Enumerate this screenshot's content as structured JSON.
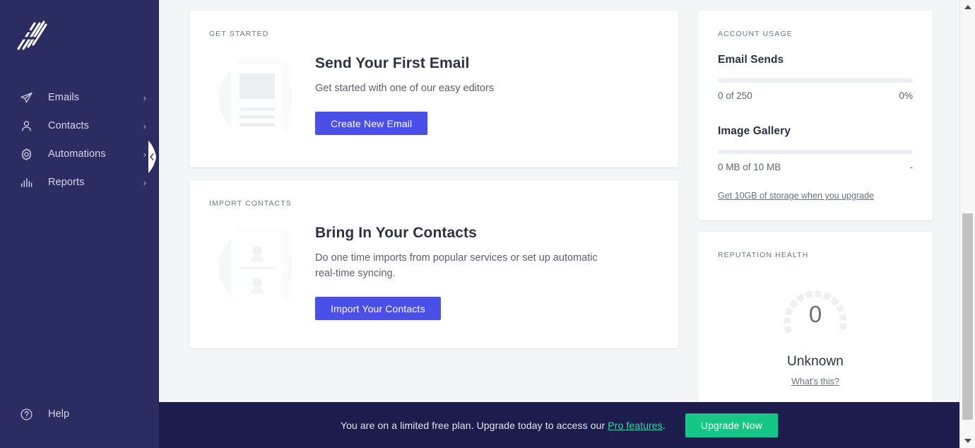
{
  "sidebar": {
    "logo_name": "brand-logo",
    "items": [
      {
        "label": "Emails",
        "icon": "paper-plane-icon",
        "chevron": "›"
      },
      {
        "label": "Contacts",
        "icon": "person-icon",
        "chevron": "›"
      },
      {
        "label": "Automations",
        "icon": "gear-icon",
        "chevron": "›"
      },
      {
        "label": "Reports",
        "icon": "bar-chart-icon",
        "chevron": "›"
      }
    ],
    "help": {
      "label": "Help",
      "icon": "question-circle-icon"
    },
    "collapse_icon": "chevron-left-icon"
  },
  "cards": {
    "get_started": {
      "eyebrow": "GET STARTED",
      "title": "Send Your First Email",
      "subtitle": "Get started with one of our easy editors",
      "button": "Create New Email",
      "art": "document-illustration"
    },
    "import_contacts": {
      "eyebrow": "IMPORT CONTACTS",
      "title": "Bring In Your Contacts",
      "subtitle": "Do one time imports from popular services or set up automatic real-time syncing.",
      "button": "Import Your Contacts",
      "art": "contact-card-illustration"
    }
  },
  "account_usage": {
    "eyebrow": "ACCOUNT USAGE",
    "metrics": [
      {
        "name": "Email Sends",
        "value_text": "0 of 250",
        "percent_text": "0%",
        "percent": 0
      },
      {
        "name": "Image Gallery",
        "value_text": "0 MB of 10 MB",
        "percent_text": "-",
        "percent": 0
      }
    ],
    "storage_link": "Get 10GB of storage when you upgrade"
  },
  "reputation": {
    "eyebrow": "REPUTATION HEALTH",
    "score": "0",
    "status": "Unknown",
    "link": "What's this?"
  },
  "banner": {
    "text_before": "You are on a limited free plan. Upgrade today to access our ",
    "link": "Pro features",
    "text_after": ".",
    "button": "Upgrade Now"
  },
  "colors": {
    "sidebar_bg": "#2b2c61",
    "banner_bg": "#1c1d4c",
    "primary_button": "#4a4fe8",
    "upgrade_button": "#15c787",
    "banner_link": "#3bd6a0",
    "page_bg": "#f4f5f7",
    "card_bg": "#ffffff"
  },
  "scrollbar": {
    "up_icon": "scroll-up-arrow-icon",
    "down_icon": "scroll-down-arrow-icon"
  }
}
